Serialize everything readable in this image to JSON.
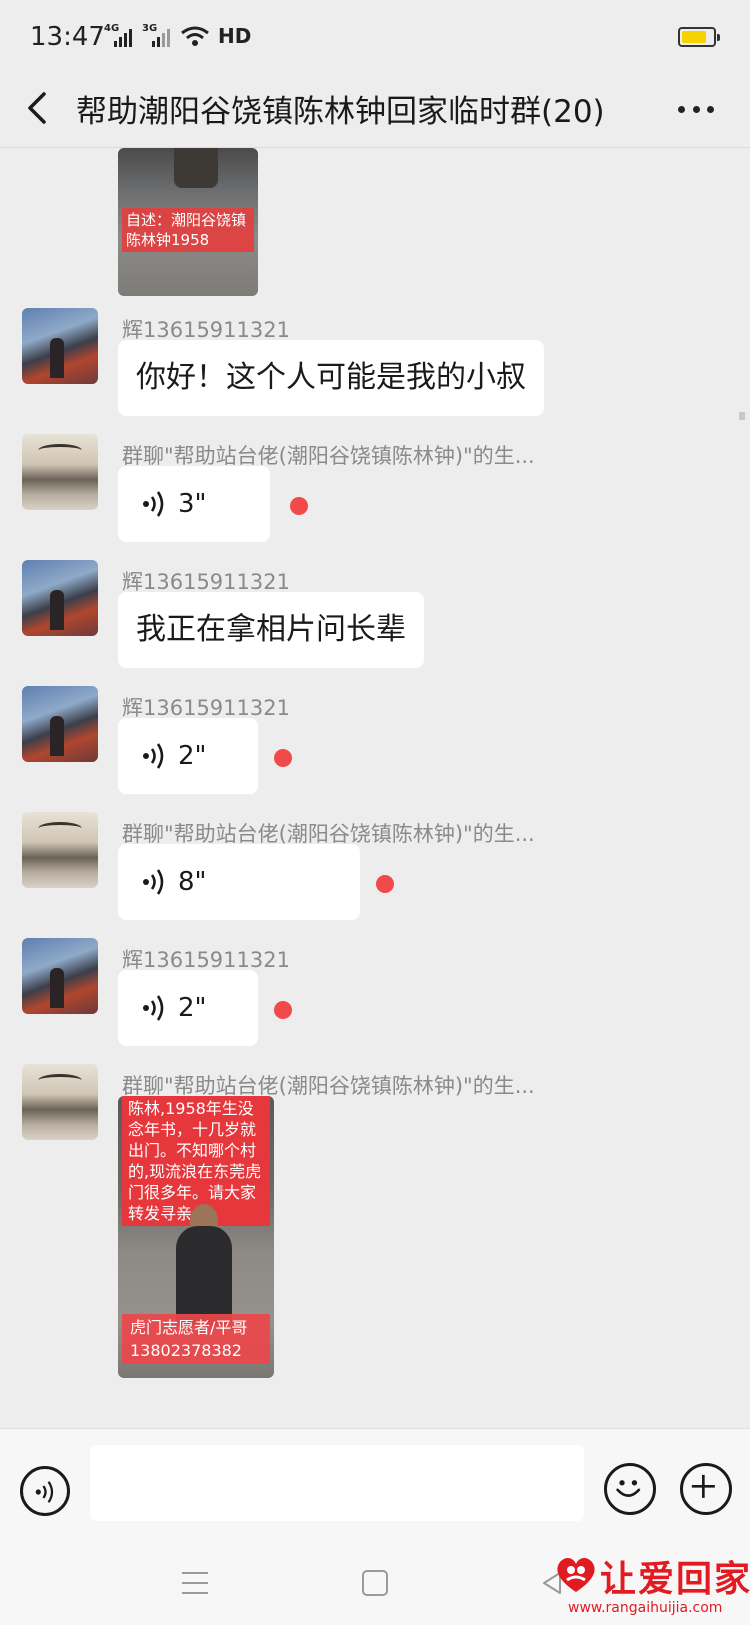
{
  "status_bar": {
    "time": "13:47",
    "network_1": "4G",
    "network_2": "3G",
    "hd_label": "HD",
    "battery_color": "#f5d200"
  },
  "header": {
    "title": "帮助潮阳谷饶镇陈林钟回家临时群(20)",
    "back_icon": "chevron-left-icon",
    "more_icon": "more-dots-icon"
  },
  "messages": [
    {
      "type": "image",
      "caption": "自述：潮阳谷饶镇陈林钟1958"
    },
    {
      "sender": "辉13615911321",
      "avatar": "avatar-hui",
      "type": "text",
      "text": "你好！这个人可能是我的小叔"
    },
    {
      "sender": "群聊\"帮助站台佬(潮阳谷饶镇陈林钟)\"的生...",
      "avatar": "avatar-group",
      "type": "voice",
      "duration": "3\"",
      "unread": true
    },
    {
      "sender": "辉13615911321",
      "avatar": "avatar-hui",
      "type": "text",
      "text": "我正在拿相片问长辈"
    },
    {
      "sender": "辉13615911321",
      "avatar": "avatar-hui",
      "type": "voice",
      "duration": "2\"",
      "unread": true
    },
    {
      "sender": "群聊\"帮助站台佬(潮阳谷饶镇陈林钟)\"的生...",
      "avatar": "avatar-group",
      "type": "voice",
      "duration": "8\"",
      "unread": true
    },
    {
      "sender": "辉13615911321",
      "avatar": "avatar-hui",
      "type": "voice",
      "duration": "2\"",
      "unread": true
    },
    {
      "sender": "群聊\"帮助站台佬(潮阳谷饶镇陈林钟)\"的生...",
      "avatar": "avatar-group",
      "type": "image",
      "banner": "陈林,1958年生没念年书，十几岁就出门。不知哪个村的,现流浪在东莞虎门很多年。请大家转发寻亲",
      "footer": "虎门志愿者/平哥 13802378382"
    }
  ],
  "input_bar": {
    "placeholder": "",
    "voice_icon": "voice-toggle-icon",
    "emoji_icon": "emoji-icon",
    "plus_icon": "plus-icon"
  },
  "watermark": {
    "title": "让爱回家",
    "url": "www.rangaihuijia.com",
    "color": "#e21b22"
  },
  "colors": {
    "background": "#ededed",
    "bubble": "#ffffff",
    "unread_dot": "#f04a4a",
    "sender_name": "#8a8a8a"
  }
}
